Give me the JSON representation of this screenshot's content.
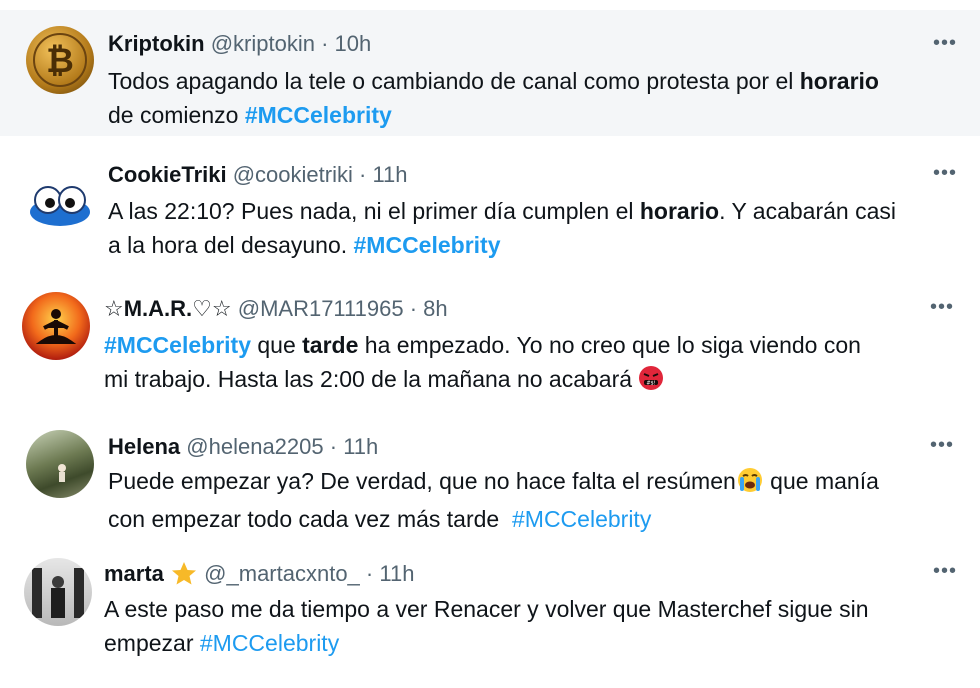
{
  "tweets": [
    {
      "name": "Kriptokin",
      "handle": "@kriptokin",
      "time": "10h",
      "text_a": "Todos apagando la tele o cambiando de canal como protesta por el ",
      "bold": "horario",
      "text_b": "de comienzo ",
      "hashtag": "#MCCelebrity",
      "bg": "#f4f6f8"
    },
    {
      "name": "CookieTriki",
      "handle": "@cookietriki",
      "time": "11h",
      "text_a": "A las 22:10? Pues nada, ni el primer día cumplen el ",
      "bold": "horario",
      "text_b": ". Y acabarán casi",
      "text_c": "a la hora del desayuno. ",
      "hashtag": "#MCCelebrity"
    },
    {
      "name": "☆M.A.R.♡☆",
      "handle": "@MAR17111965",
      "time": "8h",
      "hashtag": "#MCCelebrity",
      "text_a": " que ",
      "bold": "tarde",
      "text_b": " ha empezado. Yo no creo que lo siga viendo con",
      "text_c": "mi trabajo. Hasta las 2:00 de la mañana no acabará ",
      "emoji": "angry-face-with-symbols"
    },
    {
      "name": "Helena",
      "handle": "@helena2205",
      "time": "11h",
      "text_a": "Puede empezar ya? De verdad, que no hace falta el resúmen",
      "text_b": " que manía",
      "text_c": "con empezar todo cada vez más tarde  ",
      "hashtag": "#MCCelebrity",
      "emoji": "loudly-crying-face"
    },
    {
      "name": "marta",
      "handle": "@_martacxnto_",
      "time": "11h",
      "text_a": "A este paso me da tiempo a ver Renacer y volver que Masterchef sigue sin",
      "text_b": "empezar ",
      "hashtag": "#MCCelebrity",
      "badge": "star-icon"
    }
  ],
  "separator": "·",
  "more_label": "•••"
}
